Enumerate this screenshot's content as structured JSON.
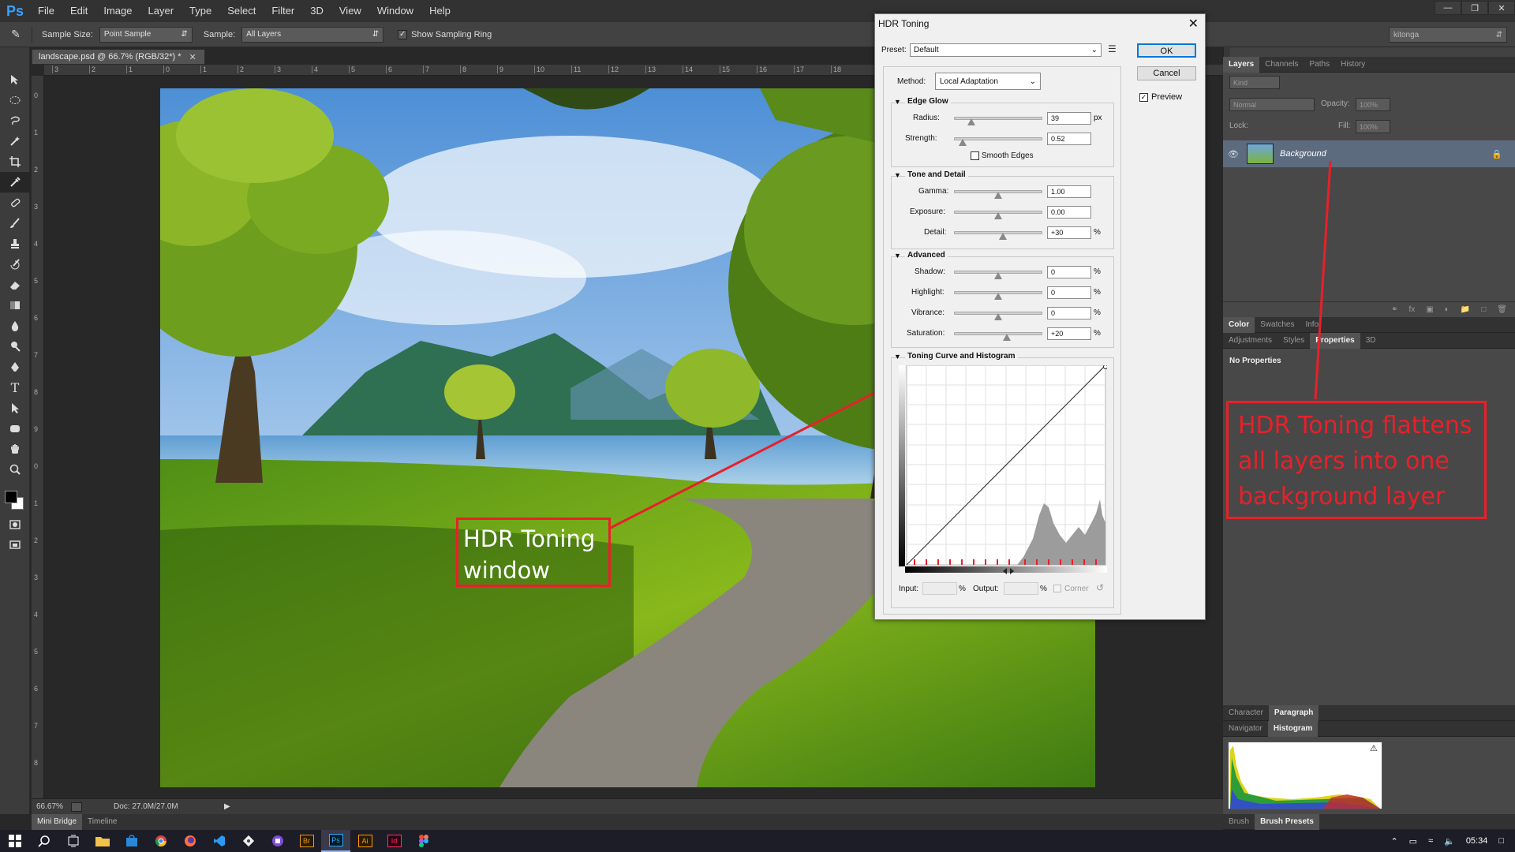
{
  "menubar": {
    "logo": "Ps",
    "items": [
      "File",
      "Edit",
      "Image",
      "Layer",
      "Type",
      "Select",
      "Filter",
      "3D",
      "View",
      "Window",
      "Help"
    ]
  },
  "options": {
    "sample_size_label": "Sample Size:",
    "sample_size_value": "Point Sample",
    "sample_label": "Sample:",
    "sample_value": "All Layers",
    "sampling_ring_label": "Show Sampling Ring",
    "workspace": "kitonga"
  },
  "document": {
    "tab_title": "landscape.psd @ 66.7% (RGB/32*) *",
    "zoom": "66.67%",
    "doc_size": "Doc: 27.0M/27.0M",
    "ruler_h": [
      "3",
      "2",
      "1",
      "0",
      "1",
      "2",
      "3",
      "4",
      "5",
      "6",
      "7",
      "8",
      "9",
      "10",
      "11",
      "12",
      "13",
      "14",
      "15",
      "16",
      "17",
      "18"
    ],
    "ruler_v": [
      "0",
      "1",
      "2",
      "3",
      "4",
      "5",
      "6",
      "7",
      "8",
      "9",
      "0",
      "1",
      "2",
      "3",
      "4",
      "5",
      "6",
      "7",
      "8"
    ]
  },
  "bottom_tabs": [
    "Mini Bridge",
    "Timeline"
  ],
  "layers_panel": {
    "tabs": [
      "Layers",
      "Channels",
      "Paths",
      "History"
    ],
    "kind": "Kind",
    "blend": "Normal",
    "opacity_label": "Opacity:",
    "opacity_value": "100%",
    "lock_label": "Lock:",
    "fill_label": "Fill:",
    "fill_value": "100%",
    "layer_name": "Background"
  },
  "color_panel": {
    "tabs": [
      "Color",
      "Swatches",
      "Info"
    ]
  },
  "properties_panel": {
    "tabs": [
      "Adjustments",
      "Styles",
      "Properties",
      "3D"
    ],
    "text": "No Properties"
  },
  "char_panel": {
    "tabs": [
      "Character",
      "Paragraph"
    ]
  },
  "nav_panel": {
    "tabs": [
      "Navigator",
      "Histogram"
    ]
  },
  "brush_panel": {
    "tabs": [
      "Brush",
      "Brush Presets"
    ]
  },
  "dialog": {
    "title": "HDR Toning",
    "preset_label": "Preset:",
    "preset_value": "Default",
    "ok": "OK",
    "cancel": "Cancel",
    "preview_label": "Preview",
    "preview_checked": true,
    "method_label": "Method:",
    "method_value": "Local Adaptation",
    "edge_glow": {
      "title": "Edge Glow",
      "radius_label": "Radius:",
      "radius_value": "39",
      "radius_unit": "px",
      "radius_pos": 0.2,
      "strength_label": "Strength:",
      "strength_value": "0.52",
      "strength_pos": 0.1,
      "smooth_label": "Smooth Edges"
    },
    "tone_detail": {
      "title": "Tone and Detail",
      "gamma_label": "Gamma:",
      "gamma_value": "1.00",
      "gamma_pos": 0.5,
      "exposure_label": "Exposure:",
      "exposure_value": "0.00",
      "exposure_pos": 0.5,
      "detail_label": "Detail:",
      "detail_value": "+30",
      "detail_unit": "%",
      "detail_pos": 0.55
    },
    "advanced": {
      "title": "Advanced",
      "shadow_label": "Shadow:",
      "shadow_value": "0",
      "shadow_pos": 0.5,
      "highlight_label": "Highlight:",
      "highlight_value": "0",
      "highlight_pos": 0.5,
      "vibrance_label": "Vibrance:",
      "vibrance_value": "0",
      "vibrance_pos": 0.5,
      "saturation_label": "Saturation:",
      "saturation_value": "+20",
      "saturation_pos": 0.6,
      "unit": "%"
    },
    "curve": {
      "title": "Toning Curve and Histogram",
      "input_label": "Input:",
      "output_label": "Output:",
      "unit": "%",
      "corner_label": "Corner"
    }
  },
  "annotations": {
    "window": "HDR Toning window",
    "flatten": "HDR Toning flattens all layers into one background layer",
    "color": "#e8202a"
  },
  "taskbar": {
    "time": "05:34"
  }
}
